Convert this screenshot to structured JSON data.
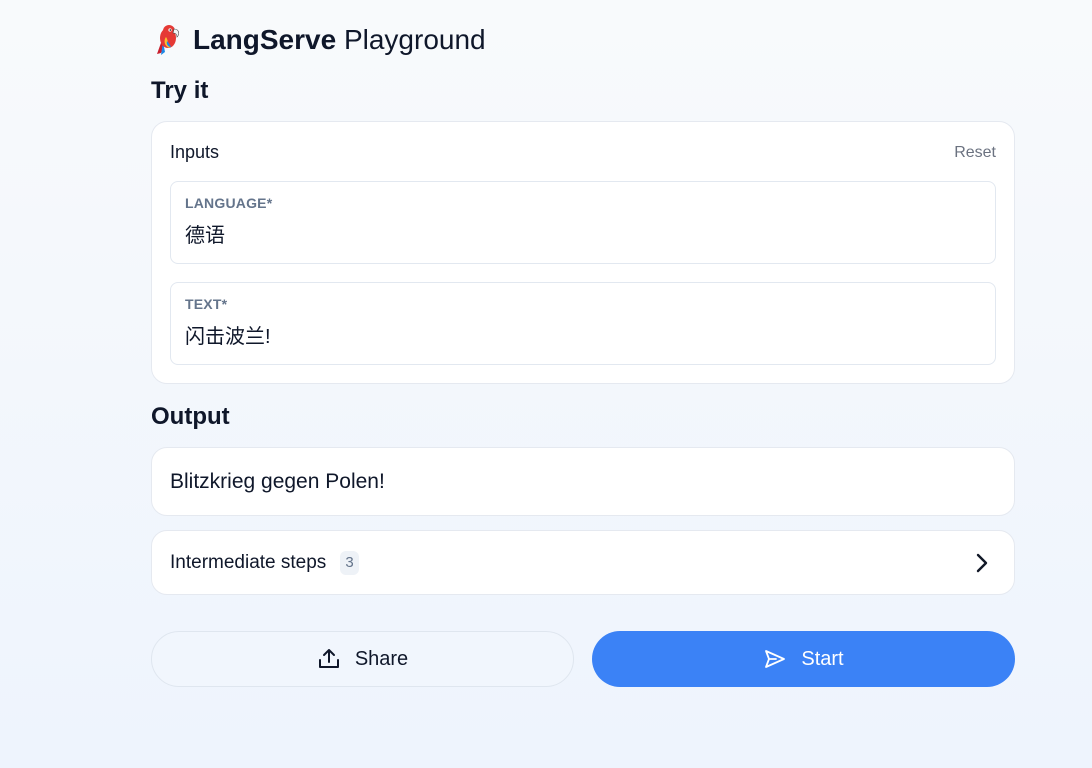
{
  "header": {
    "logo_icon": "parrot-icon",
    "brand": "LangServe",
    "subtitle": "Playground"
  },
  "try_it": {
    "title": "Try it",
    "inputs_label": "Inputs",
    "reset_label": "Reset",
    "fields": [
      {
        "label": "LANGUAGE*",
        "value": "德语"
      },
      {
        "label": "TEXT*",
        "value": "闪击波兰!"
      }
    ]
  },
  "output": {
    "title": "Output",
    "text": "Blitzkrieg gegen Polen!",
    "intermediate_steps": {
      "label": "Intermediate steps",
      "count": "3",
      "icon": "chevron-right-icon"
    }
  },
  "actions": {
    "share_label": "Share",
    "share_icon": "share-upload-icon",
    "start_label": "Start",
    "start_icon": "send-icon"
  },
  "colors": {
    "accent": "#3b82f6",
    "text": "#0f172a",
    "muted": "#64748b",
    "border": "#e5e9f0"
  }
}
